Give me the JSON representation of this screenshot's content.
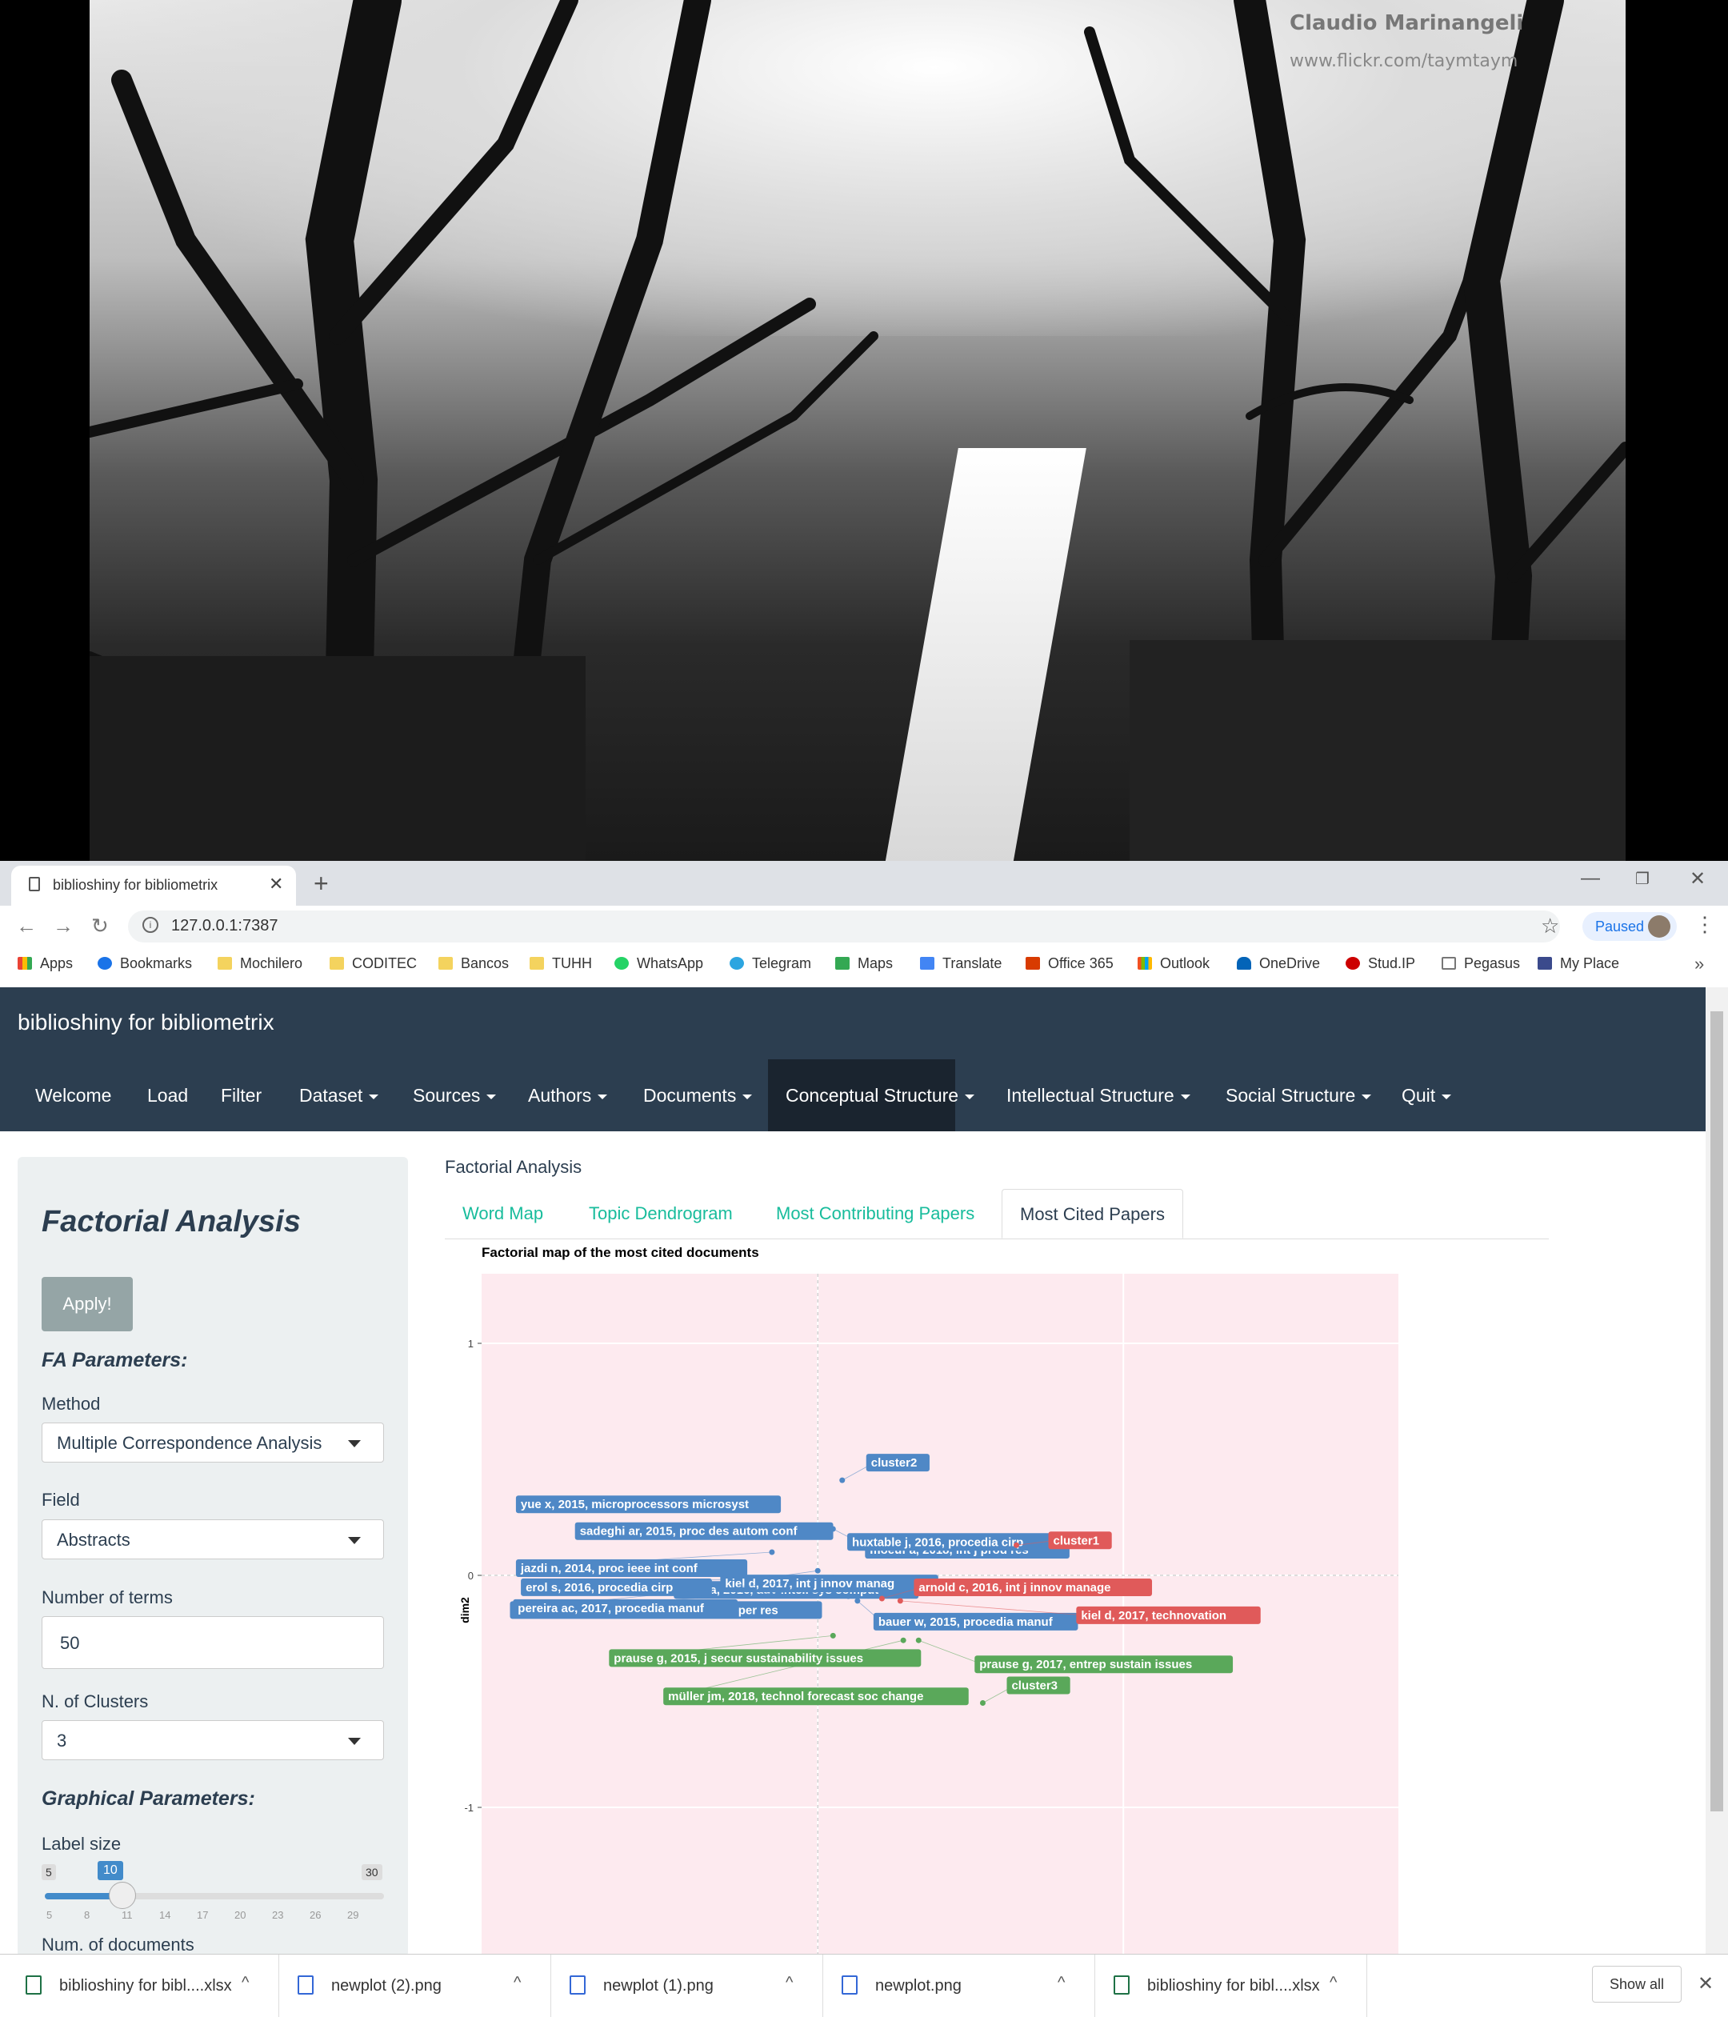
{
  "wallpaper": {
    "credit_name": "Claudio Marinangeli",
    "credit_url": "www.flickr.com/taymtaym"
  },
  "browser": {
    "tab_title": "biblioshiny for bibliometrix",
    "url": "127.0.0.1:7387",
    "profile_status": "Paused",
    "bookmarks": [
      "Apps",
      "Bookmarks",
      "Mochilero",
      "CODITEC",
      "Bancos",
      "TUHH",
      "WhatsApp",
      "Telegram",
      "Maps",
      "Translate",
      "Office 365",
      "Outlook",
      "OneDrive",
      "Stud.IP",
      "Pegasus",
      "My Place"
    ]
  },
  "app": {
    "brand": "biblioshiny for bibliometrix",
    "nav": [
      "Welcome",
      "Load",
      "Filter",
      "Dataset",
      "Sources",
      "Authors",
      "Documents",
      "Conceptual Structure",
      "Intellectual Structure",
      "Social Structure",
      "Quit"
    ],
    "active_nav": "Conceptual Structure"
  },
  "sidebar": {
    "title": "Factorial Analysis",
    "apply_label": "Apply!",
    "fa_params_heading": "FA Parameters:",
    "method_label": "Method",
    "method_value": "Multiple Correspondence Analysis",
    "field_label": "Field",
    "field_value": "Abstracts",
    "terms_label": "Number of terms",
    "terms_value": "50",
    "clusters_label": "N. of Clusters",
    "clusters_value": "3",
    "graph_params_heading": "Graphical Parameters:",
    "label_size_label": "Label size",
    "label_size": {
      "min": "5",
      "max": "30",
      "value": "10",
      "ticks": [
        "5",
        "8",
        "11",
        "14",
        "17",
        "20",
        "23",
        "26",
        "29"
      ]
    },
    "num_docs_label": "Num. of documents"
  },
  "main": {
    "title": "Factorial Analysis",
    "tabs": [
      "Word Map",
      "Topic Dendrogram",
      "Most Contributing Papers",
      "Most Cited Papers"
    ],
    "active_tab": "Most Cited Papers"
  },
  "chart_data": {
    "type": "scatter",
    "title": "Factorial map of the most cited documents",
    "xlabel": "",
    "ylabel": "dim2",
    "yticks": [
      "1",
      "0",
      "-1"
    ],
    "xlim": [
      -1.1,
      1.9
    ],
    "ylim": [
      -1.7,
      1.3
    ],
    "colors": {
      "cluster1": "#e05a5a",
      "cluster2": "#4f88c6",
      "cluster3": "#5aa85a",
      "panel": "#fdeaef"
    },
    "points": [
      {
        "label": "cluster2",
        "x": 0.08,
        "y": 0.41,
        "cluster": 2,
        "centroid": true
      },
      {
        "label": "yue x, 2015, microprocessors microsyst",
        "x": -0.15,
        "y": 0.32,
        "cluster": 2
      },
      {
        "label": "moeuf a, 2018, int j prod res",
        "x": 0.05,
        "y": 0.2,
        "cluster": 2
      },
      {
        "label": "sadeghi ar, 2015, proc des autom conf",
        "x": -0.14,
        "y": 0.17,
        "cluster": 2
      },
      {
        "label": "huxtable j, 2016, procedia cirp",
        "x": 0.62,
        "y": 0.13,
        "cluster": 2
      },
      {
        "label": "jazdi n, 2014, proc ieee int conf",
        "x": -0.15,
        "y": 0.1,
        "cluster": 2
      },
      {
        "label": "khan a, 2016, adv intell sys comput",
        "x": 0.0,
        "y": 0.02,
        "cluster": 2
      },
      {
        "label": "erol s, 2016, procedia cirp",
        "x": -0.16,
        "y": -0.01,
        "cluster": 2
      },
      {
        "label": "kiel d, 2017, int j innov manag",
        "x": 0.1,
        "y": -0.09,
        "cluster": 2
      },
      {
        "label": "lopes de sousa jabbour ab, 2018, ann oper res",
        "x": 0.04,
        "y": -0.06,
        "cluster": 2
      },
      {
        "label": "bauer w, 2015, procedia manuf",
        "x": 0.13,
        "y": -0.11,
        "cluster": 2
      },
      {
        "label": "pereira ac, 2017, procedia manuf",
        "x": 0.05,
        "y": -0.01,
        "cluster": 2
      },
      {
        "label": "cluster1",
        "x": 0.65,
        "y": 0.13,
        "cluster": 1,
        "centroid": true
      },
      {
        "label": "arnold c, 2016, int j innov manage",
        "x": 0.21,
        "y": -0.1,
        "cluster": 1
      },
      {
        "label": "kiel d, 2017, technovation",
        "x": 0.27,
        "y": -0.11,
        "cluster": 1
      },
      {
        "label": "cluster3",
        "x": 0.54,
        "y": -0.55,
        "cluster": 3,
        "centroid": true
      },
      {
        "label": "prause g, 2015, j secur sustainability issues",
        "x": 0.05,
        "y": -0.26,
        "cluster": 3
      },
      {
        "label": "prause g, 2017, entrep sustain issues",
        "x": 0.33,
        "y": -0.28,
        "cluster": 3
      },
      {
        "label": "müller jm, 2018, technol forecast soc change",
        "x": 0.28,
        "y": -0.28,
        "cluster": 3
      }
    ]
  },
  "downloads": [
    {
      "name": "biblioshiny for bibl....xlsx",
      "kind": "xlsx"
    },
    {
      "name": "newplot (2).png",
      "kind": "png"
    },
    {
      "name": "newplot (1).png",
      "kind": "png"
    },
    {
      "name": "newplot.png",
      "kind": "png"
    },
    {
      "name": "biblioshiny for bibl....xlsx",
      "kind": "xlsx"
    }
  ],
  "show_all_label": "Show all"
}
